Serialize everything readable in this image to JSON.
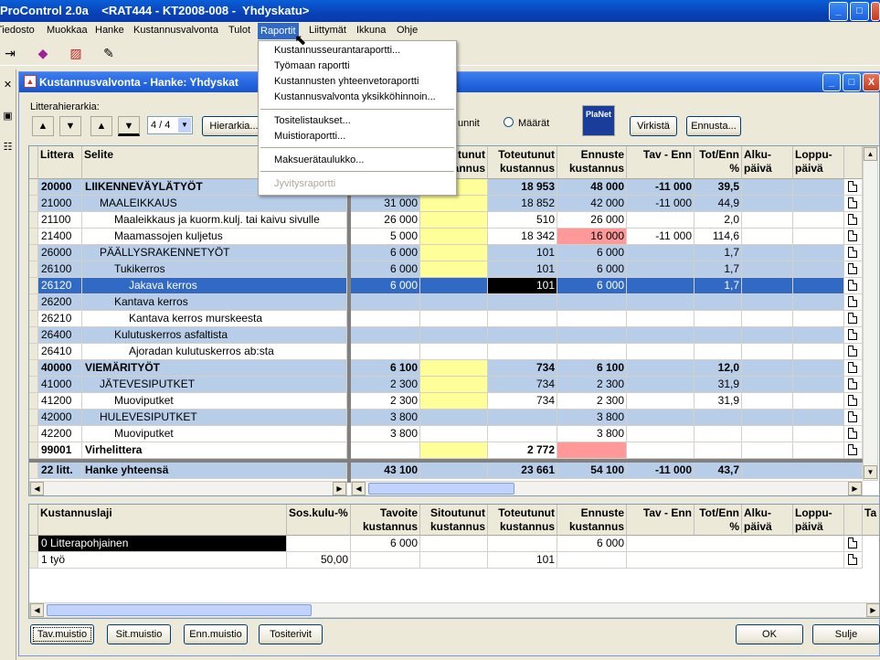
{
  "app": {
    "title": "ProControl 2.0a    <RAT444 - KT2008-008 -  Yhdyskatu>",
    "window_buttons": {
      "minimize": "_",
      "maximize": "□",
      "close": "X"
    }
  },
  "menubar": {
    "items": [
      "Tiedosto",
      "Muokkaa",
      "Hanke",
      "Kustannusvalvonta",
      "Tulot",
      "Raportit",
      "Liittymät",
      "Ikkuna",
      "Ohje"
    ],
    "active": "Raportit"
  },
  "dropdown": {
    "items": [
      "Kustannusseurantaraportti...",
      "Työmaan raportti",
      "Kustannusten yhteenvetoraportti",
      "Kustannusvalvonta yksikköhinnoin..."
    ],
    "items2": [
      "Tositelistaukset...",
      "Muistioraportti..."
    ],
    "items3": [
      "Maksuerätaulukko..."
    ],
    "disabled": "Jyvitysraportti"
  },
  "child": {
    "title": "Kustannusvalvonta - Hanke: Yhdyskat",
    "hierarchy_label": "Litterahierarkia:",
    "level_select": "4 / 4",
    "hierarchy_button": "Hierarkia...",
    "radio_label_partial": "unnit",
    "radio_maarat": "Määrät",
    "planet_label": "PlaNet",
    "virkista_button": "Virkistä",
    "ennusta_button": "Ennusta..."
  },
  "colors": {
    "header_blue": "#b8cde8",
    "yellow": "#ffff99",
    "pink": "#ff9999",
    "selected": "#316ac5",
    "title_blue": "#0a5fd8"
  },
  "main_grid": {
    "left_headers": [
      "Littera",
      "Selite"
    ],
    "right_headers": [
      "Tavoite\nkustannus",
      "Sitoutunut\nkustannus",
      "Toteutunut\nkustannus",
      "Ennuste\nkustannus",
      "Tav - Enn",
      "Tot/Enn\n%",
      "Alku-\npäivä",
      "Loppu-\npäivä"
    ],
    "rows": [
      {
        "littera": "20000",
        "selite": "LIIKENNEVÄYLÄTYÖT",
        "indent": 0,
        "style": "group-bold",
        "tav": "",
        "sit": "",
        "tot": "18 953",
        "enn": "48 000",
        "tavenn": "-11 000",
        "totenn": "39,5",
        "sit_yellow": true
      },
      {
        "littera": "21000",
        "selite": "MAALEIKKAUS",
        "indent": 1,
        "style": "group",
        "tav": "31 000",
        "sit": "",
        "tot": "18 852",
        "enn": "42 000",
        "tavenn": "-11 000",
        "totenn": "44,9",
        "sit_yellow": true
      },
      {
        "littera": "21100",
        "selite": "Maaleikkaus ja kuorm.kulj. tai kaivu sivulle",
        "indent": 2,
        "style": "plain",
        "tav": "26 000",
        "sit": "",
        "tot": "510",
        "enn": "26 000",
        "tavenn": "",
        "totenn": "2,0",
        "sit_yellow": true
      },
      {
        "littera": "21400",
        "selite": "Maamassojen kuljetus",
        "indent": 2,
        "style": "plain",
        "tav": "5 000",
        "sit": "",
        "tot": "18 342",
        "enn": "16 000",
        "tavenn": "-11 000",
        "totenn": "114,6",
        "sit_yellow": true,
        "enn_pink": true
      },
      {
        "littera": "26000",
        "selite": "PÄÄLLYSRAKENNETYÖT",
        "indent": 1,
        "style": "group",
        "tav": "6 000",
        "sit": "",
        "tot": "101",
        "enn": "6 000",
        "tavenn": "",
        "totenn": "1,7",
        "sit_yellow": true
      },
      {
        "littera": "26100",
        "selite": "Tukikerros",
        "indent": 2,
        "style": "group",
        "tav": "6 000",
        "sit": "",
        "tot": "101",
        "enn": "6 000",
        "tavenn": "",
        "totenn": "1,7",
        "sit_yellow": true
      },
      {
        "littera": "26120",
        "selite": "Jakava kerros",
        "indent": 3,
        "style": "selected",
        "tav": "6 000",
        "sit": "",
        "tot": "101",
        "enn": "6 000",
        "tavenn": "",
        "totenn": "1,7"
      },
      {
        "littera": "26200",
        "selite": "Kantava kerros",
        "indent": 2,
        "style": "group",
        "tav": "",
        "sit": "",
        "tot": "",
        "enn": "",
        "tavenn": "",
        "totenn": ""
      },
      {
        "littera": "26210",
        "selite": "Kantava kerros murskeesta",
        "indent": 3,
        "style": "plain",
        "tav": "",
        "sit": "",
        "tot": "",
        "enn": "",
        "tavenn": "",
        "totenn": ""
      },
      {
        "littera": "26400",
        "selite": "Kulutuskerros asfaltista",
        "indent": 2,
        "style": "group",
        "tav": "",
        "sit": "",
        "tot": "",
        "enn": "",
        "tavenn": "",
        "totenn": ""
      },
      {
        "littera": "26410",
        "selite": "Ajoradan kulutuskerros ab:sta",
        "indent": 3,
        "style": "plain",
        "tav": "",
        "sit": "",
        "tot": "",
        "enn": "",
        "tavenn": "",
        "totenn": ""
      },
      {
        "littera": "40000",
        "selite": "VIEMÄRITYÖT",
        "indent": 0,
        "style": "group-bold",
        "tav": "6 100",
        "sit": "",
        "tot": "734",
        "enn": "6 100",
        "tavenn": "",
        "totenn": "12,0",
        "sit_yellow": true
      },
      {
        "littera": "41000",
        "selite": "JÄTEVESIPUTKET",
        "indent": 1,
        "style": "group",
        "tav": "2 300",
        "sit": "",
        "tot": "734",
        "enn": "2 300",
        "tavenn": "",
        "totenn": "31,9",
        "sit_yellow": true
      },
      {
        "littera": "41200",
        "selite": "Muoviputket",
        "indent": 2,
        "style": "plain",
        "tav": "2 300",
        "sit": "",
        "tot": "734",
        "enn": "2 300",
        "tavenn": "",
        "totenn": "31,9",
        "sit_yellow": true
      },
      {
        "littera": "42000",
        "selite": "HULEVESIPUTKET",
        "indent": 1,
        "style": "group",
        "tav": "3 800",
        "sit": "",
        "tot": "",
        "enn": "3 800",
        "tavenn": "",
        "totenn": ""
      },
      {
        "littera": "42200",
        "selite": "Muoviputket",
        "indent": 2,
        "style": "plain",
        "tav": "3 800",
        "sit": "",
        "tot": "",
        "enn": "3 800",
        "tavenn": "",
        "totenn": ""
      },
      {
        "littera": "99001",
        "selite": "Virhelittera",
        "indent": 0,
        "style": "bold-plain",
        "tav": "",
        "sit": "",
        "tot": "2 772",
        "enn": "",
        "tavenn": "",
        "totenn": "",
        "sit_yellow": true,
        "enn_pink": true
      }
    ],
    "total": {
      "littera": "22 litt.",
      "selite": "Hanke yhteensä",
      "tav": "43 100",
      "sit": "",
      "tot": "23 661",
      "enn": "54 100",
      "tavenn": "-11 000",
      "totenn": "43,7"
    }
  },
  "bottom_grid": {
    "headers": [
      "Kustannuslaji",
      "Sos.kulu-%",
      "Tavoite\nkustannus",
      "Sitoutunut\nkustannus",
      "Toteutunut\nkustannus",
      "Ennuste\nkustannus",
      "Tav - Enn",
      "Tot/Enn\n%",
      "Alku-\npäivä",
      "Loppu-\npäivä",
      "Ta"
    ],
    "rows": [
      {
        "laji": "0  Litterapohjainen",
        "sos": "",
        "tav": "6 000",
        "sit": "",
        "tot": "",
        "enn": "6 000",
        "selected": true
      },
      {
        "laji": "1  työ",
        "sos": "50,00",
        "tav": "",
        "sit": "",
        "tot": "101",
        "enn": ""
      }
    ]
  },
  "footer": {
    "buttons": [
      "Tav.muistio",
      "Sit.muistio",
      "Enn.muistio",
      "Tositerivit"
    ],
    "ok": "OK",
    "sulje": "Sulje"
  }
}
